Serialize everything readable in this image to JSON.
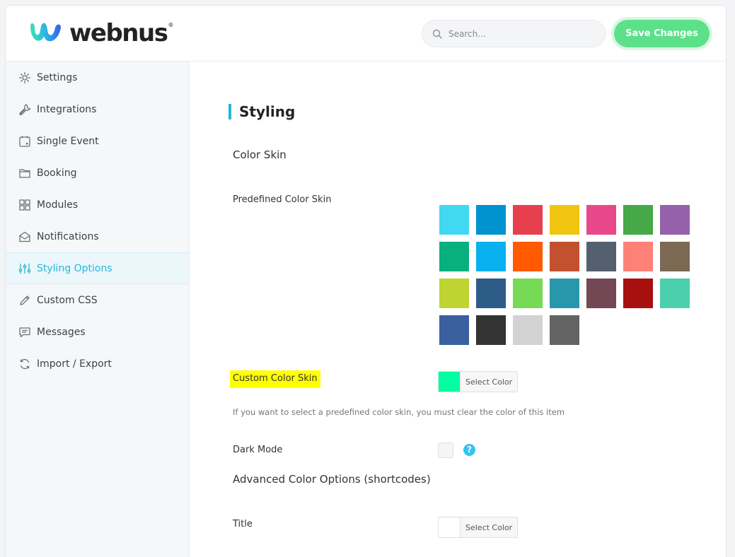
{
  "brand": {
    "name": "webnus",
    "reg": "®"
  },
  "search": {
    "placeholder": "Search..."
  },
  "header": {
    "save_label": "Save Changes"
  },
  "sidebar": {
    "items": [
      {
        "label": "Settings",
        "icon": "gear-icon",
        "active": false
      },
      {
        "label": "Integrations",
        "icon": "wrench-icon",
        "active": false
      },
      {
        "label": "Single Event",
        "icon": "calendar-icon",
        "active": false
      },
      {
        "label": "Booking",
        "icon": "folder-icon",
        "active": false
      },
      {
        "label": "Modules",
        "icon": "grid-icon",
        "active": false
      },
      {
        "label": "Notifications",
        "icon": "envelope-icon",
        "active": false
      },
      {
        "label": "Styling Options",
        "icon": "sliders-icon",
        "active": true
      },
      {
        "label": "Custom CSS",
        "icon": "pencil-icon",
        "active": false
      },
      {
        "label": "Messages",
        "icon": "chat-icon",
        "active": false
      },
      {
        "label": "Import / Export",
        "icon": "sync-icon",
        "active": false
      }
    ]
  },
  "main": {
    "title": "Styling",
    "color_skin_heading": "Color Skin",
    "predefined_label": "Predefined Color Skin",
    "swatches": [
      "#40d9f1",
      "#0093d0",
      "#e83f4f",
      "#f1c40f",
      "#e8488a",
      "#44a946",
      "#9661ab",
      "#0aaf7f",
      "#0ab1f0",
      "#ff5a00",
      "#c3512f",
      "#55606e",
      "#fe8178",
      "#7c6853",
      "#bed431",
      "#2d5c88",
      "#77da55",
      "#2997ab",
      "#734854",
      "#a81010",
      "#4ccfad",
      "#3a609f",
      "#333333",
      "#d2d2d2",
      "#636363"
    ],
    "custom_skin_label": "Custom Color Skin",
    "custom_skin_color": "#00ffa0",
    "select_color_label": "Select Color",
    "custom_skin_help": "If you want to select a predefined color skin, you must clear the color of this item",
    "dark_mode_label": "Dark Mode",
    "help_glyph": "?",
    "advanced_heading": "Advanced Color Options (shortcodes)",
    "title_label": "Title",
    "title_color": "#ffffff",
    "title_select_label": "Select Color"
  }
}
